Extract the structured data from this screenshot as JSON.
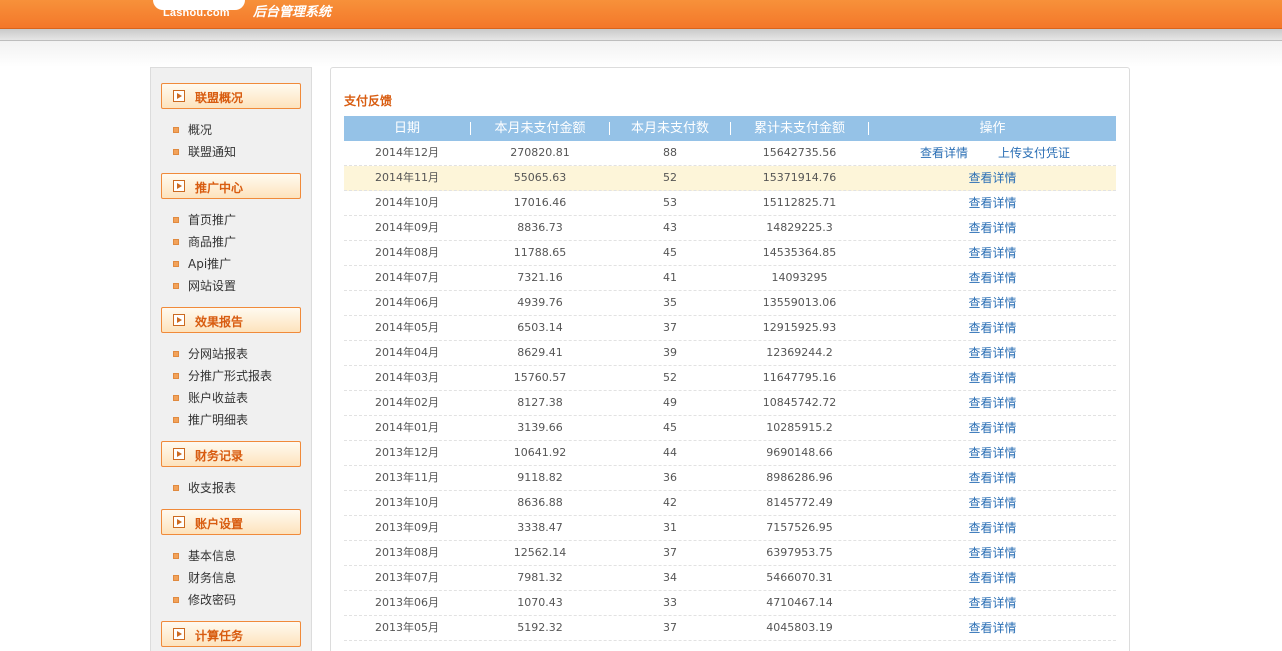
{
  "header": {
    "logo_text": "Lashou.com",
    "system_title": "后台管理系统"
  },
  "sidebar": {
    "sections": [
      {
        "title": "联盟概况",
        "items": [
          "概况",
          "联盟通知"
        ]
      },
      {
        "title": "推广中心",
        "items": [
          "首页推广",
          "商品推广",
          "Api推广",
          "网站设置"
        ]
      },
      {
        "title": "效果报告",
        "items": [
          "分网站报表",
          "分推广形式报表",
          "账户收益表",
          "推广明细表"
        ]
      },
      {
        "title": "财务记录",
        "items": [
          "收支报表"
        ]
      },
      {
        "title": "账户设置",
        "items": [
          "基本信息",
          "财务信息",
          "修改密码"
        ]
      },
      {
        "title": "计算任务",
        "items": []
      }
    ]
  },
  "main": {
    "title": "支付反馈",
    "columns": [
      "日期",
      "本月未支付金额",
      "本月未支付数",
      "累计未支付金额",
      "操作"
    ],
    "action_view": "查看详情",
    "action_upload": "上传支付凭证",
    "rows": [
      {
        "date": "2014年12月",
        "amount": "270820.81",
        "count": "88",
        "total": "15642735.56",
        "upload": true
      },
      {
        "date": "2014年11月",
        "amount": "55065.63",
        "count": "52",
        "total": "15371914.76",
        "highlight": true
      },
      {
        "date": "2014年10月",
        "amount": "17016.46",
        "count": "53",
        "total": "15112825.71"
      },
      {
        "date": "2014年09月",
        "amount": "8836.73",
        "count": "43",
        "total": "14829225.3"
      },
      {
        "date": "2014年08月",
        "amount": "11788.65",
        "count": "45",
        "total": "14535364.85"
      },
      {
        "date": "2014年07月",
        "amount": "7321.16",
        "count": "41",
        "total": "14093295"
      },
      {
        "date": "2014年06月",
        "amount": "4939.76",
        "count": "35",
        "total": "13559013.06"
      },
      {
        "date": "2014年05月",
        "amount": "6503.14",
        "count": "37",
        "total": "12915925.93"
      },
      {
        "date": "2014年04月",
        "amount": "8629.41",
        "count": "39",
        "total": "12369244.2"
      },
      {
        "date": "2014年03月",
        "amount": "15760.57",
        "count": "52",
        "total": "11647795.16"
      },
      {
        "date": "2014年02月",
        "amount": "8127.38",
        "count": "49",
        "total": "10845742.72"
      },
      {
        "date": "2014年01月",
        "amount": "3139.66",
        "count": "45",
        "total": "10285915.2"
      },
      {
        "date": "2013年12月",
        "amount": "10641.92",
        "count": "44",
        "total": "9690148.66"
      },
      {
        "date": "2013年11月",
        "amount": "9118.82",
        "count": "36",
        "total": "8986286.96"
      },
      {
        "date": "2013年10月",
        "amount": "8636.88",
        "count": "42",
        "total": "8145772.49"
      },
      {
        "date": "2013年09月",
        "amount": "3338.47",
        "count": "31",
        "total": "7157526.95"
      },
      {
        "date": "2013年08月",
        "amount": "12562.14",
        "count": "37",
        "total": "6397953.75"
      },
      {
        "date": "2013年07月",
        "amount": "7981.32",
        "count": "34",
        "total": "5466070.31"
      },
      {
        "date": "2013年06月",
        "amount": "1070.43",
        "count": "33",
        "total": "4710467.14"
      },
      {
        "date": "2013年05月",
        "amount": "5192.32",
        "count": "37",
        "total": "4045803.19"
      }
    ]
  }
}
